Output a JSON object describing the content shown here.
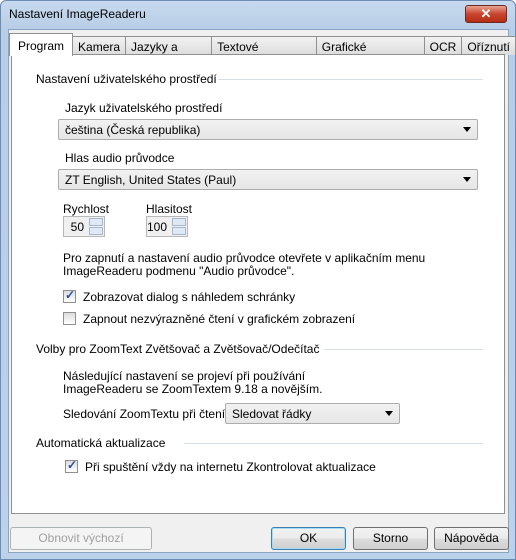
{
  "window": {
    "title": "Nastavení ImageReaderu",
    "close": "✕"
  },
  "tabs": [
    "Program",
    "Kamera",
    "Jazyky a hlasy",
    "Textové zobrazení",
    "Grafické zobrazení",
    "OCR",
    "Oříznutí"
  ],
  "ui_group": {
    "label": "Nastavení uživatelského prostředí",
    "language_label": "Jazyk uživatelského prostředí",
    "language_value": "čeština (Česká republika)",
    "voice_label": "Hlas audio průvodce",
    "voice_value": "ZT English, United States  (Paul)",
    "speed_label": "Rychlost",
    "speed_value": "50",
    "volume_label": "Hlasitost",
    "volume_value": "100",
    "info_line1": "Pro zapnutí a nastavení audio průvodce otevřete v aplikačním menu",
    "info_line2": "ImageReaderu podmenu \"Audio průvodce\".",
    "checkbox1": {
      "label": "Zobrazovat dialog s náhledem schránky",
      "checked": true
    },
    "checkbox2": {
      "label": "Zapnout nezvýrazněné čtení v grafickém zobrazení",
      "checked": false
    }
  },
  "zoomtext_group": {
    "label": "Volby pro ZoomText Zvětšovač a Zvětšovač/Odečítač",
    "info_line1": "Následující nastavení se projeví při používání",
    "info_line2": "ImageReaderu se ZoomTextem 9.18 a novějším.",
    "tracking_label": "Sledování ZoomTextu při čtení:",
    "tracking_value": "Sledovat řádky"
  },
  "update_group": {
    "label": "Automatická aktualizace",
    "checkbox": {
      "label": "Při spuštění vždy na internetu Zkontrolovat aktualizace",
      "checked": true
    }
  },
  "buttons": {
    "reset": "Obnovit výchozí",
    "ok": "OK",
    "cancel": "Storno",
    "help": "Nápověda"
  }
}
